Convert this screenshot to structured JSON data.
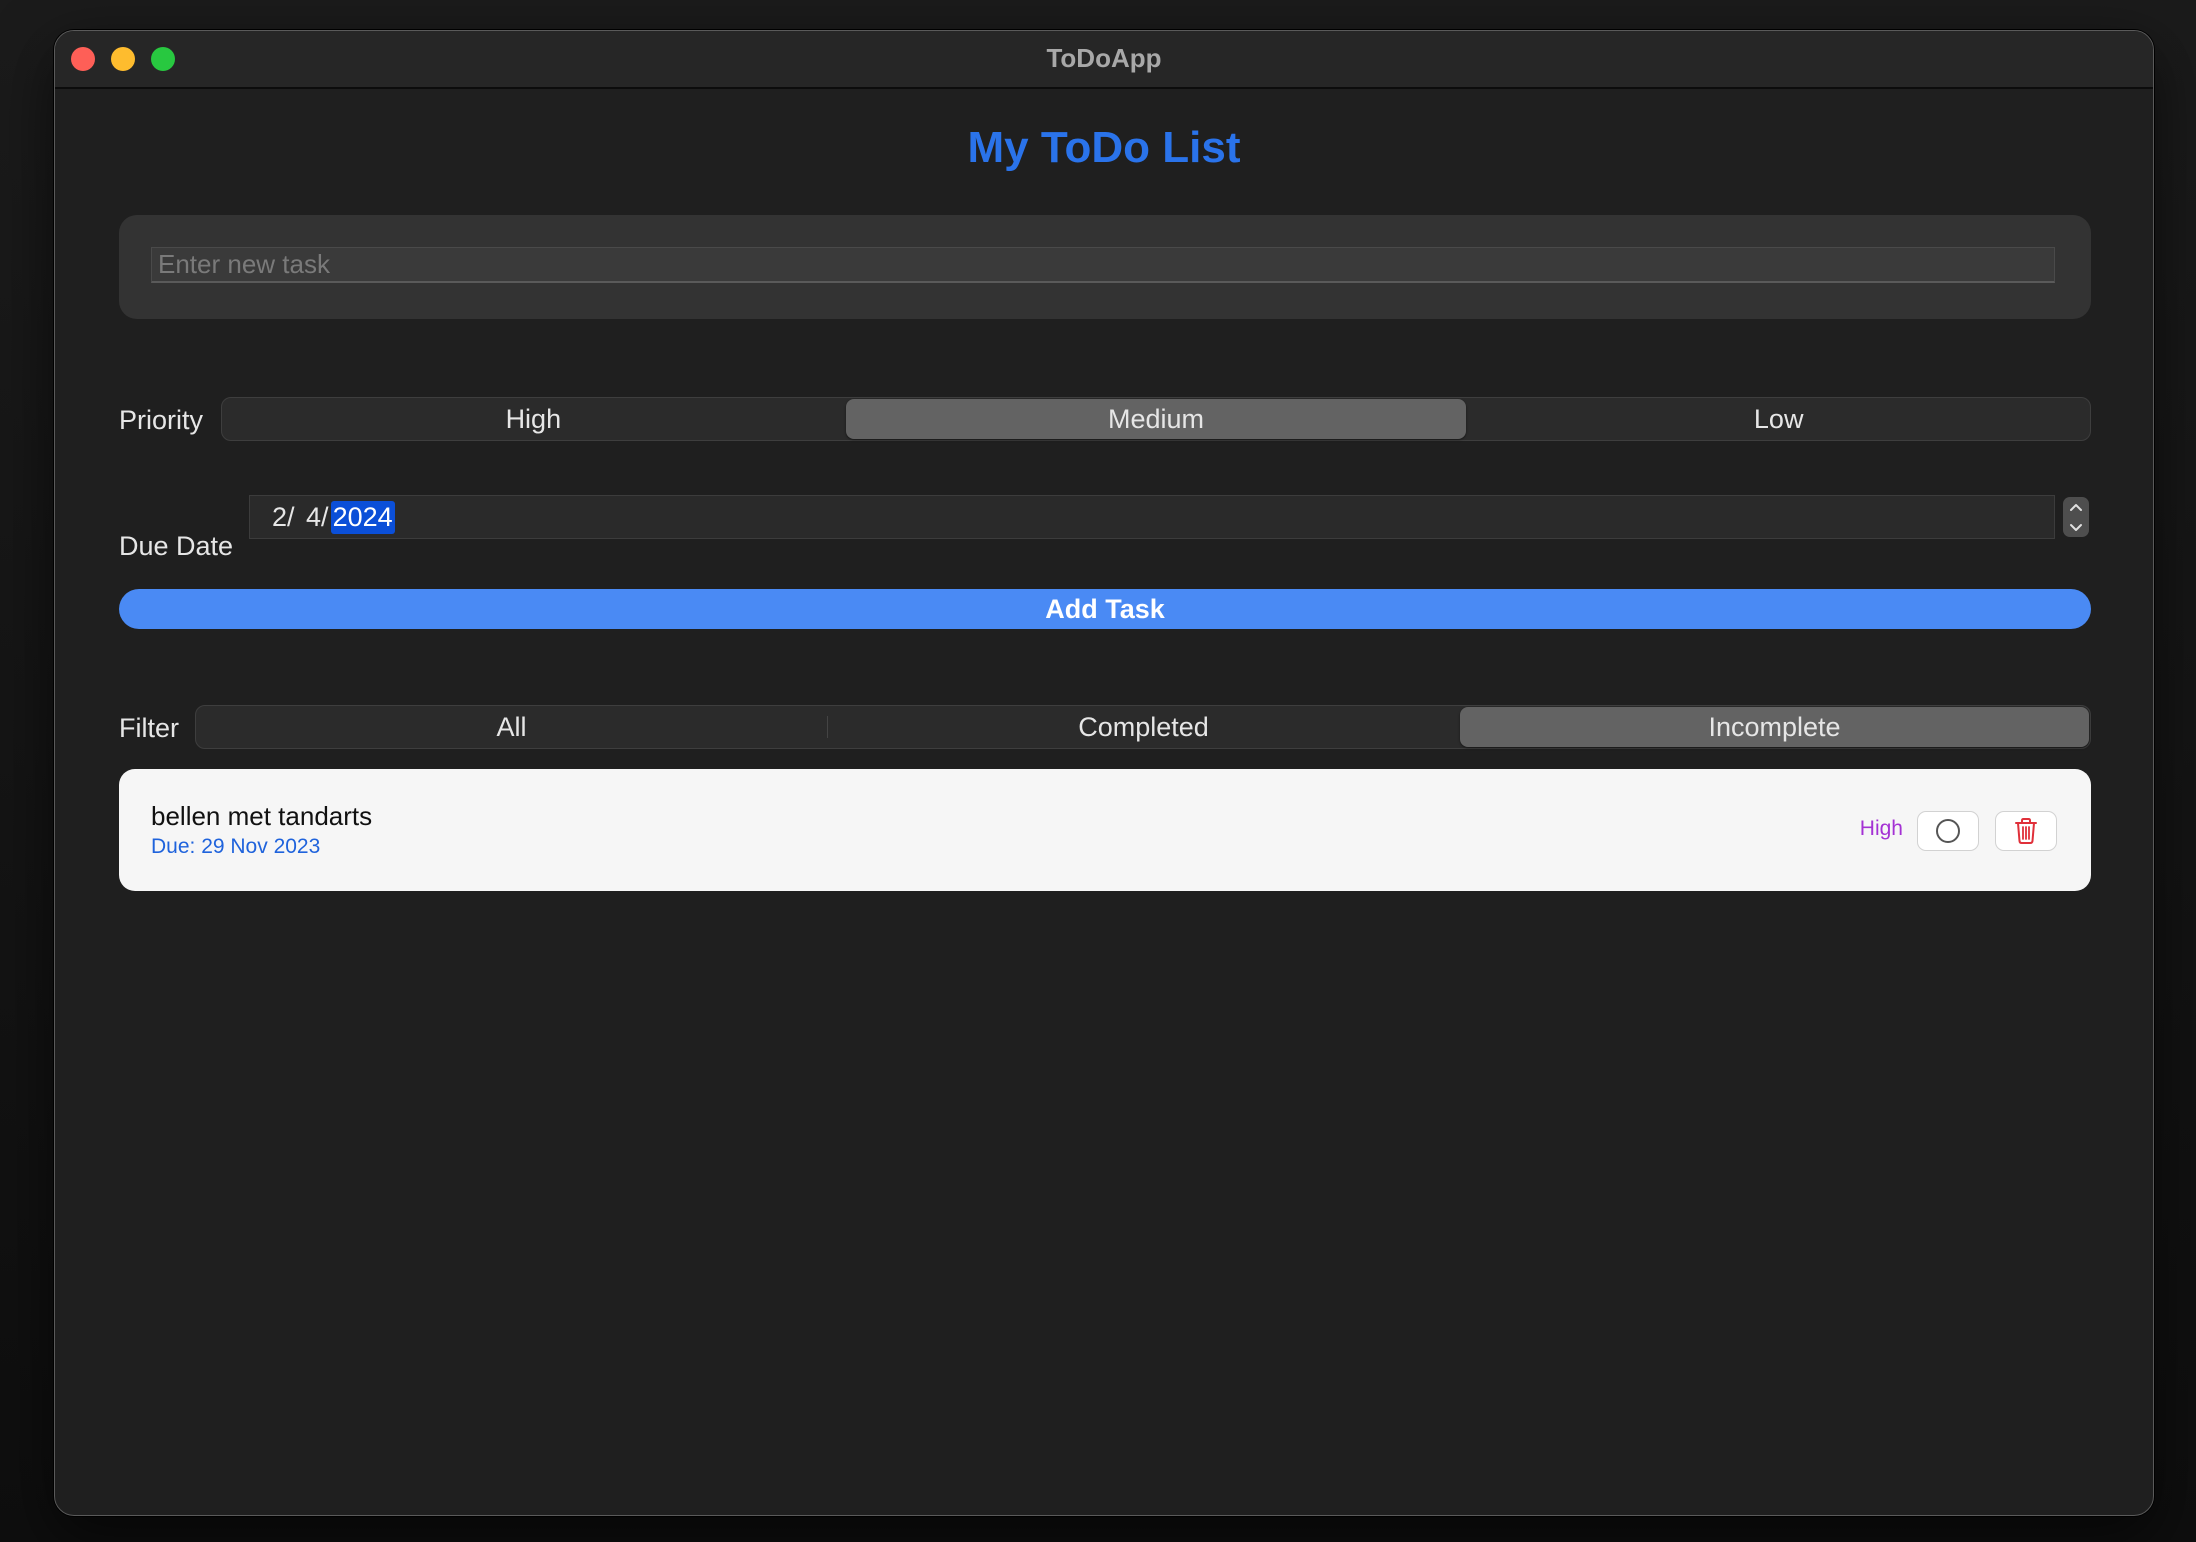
{
  "window": {
    "title": "ToDoApp"
  },
  "app": {
    "title": "My ToDo List"
  },
  "new_task": {
    "value": "",
    "placeholder": "Enter new task"
  },
  "priority": {
    "label": "Priority",
    "options": [
      "High",
      "Medium",
      "Low"
    ],
    "selected": "Medium"
  },
  "due_date": {
    "label": "Due Date",
    "month": "2/",
    "day": " 4/",
    "year": "2024",
    "selected_part": "year"
  },
  "add_button": {
    "label": "Add Task"
  },
  "filter": {
    "label": "Filter",
    "options": [
      "All",
      "Completed",
      "Incomplete"
    ],
    "selected": "Incomplete"
  },
  "tasks": [
    {
      "title": "bellen met tandarts",
      "due": "Due: 29 Nov 2023",
      "priority": "High",
      "completed": false,
      "toggle_icon": "circle-icon",
      "delete_icon": "trash-icon"
    }
  ],
  "colors": {
    "accent": "#2a73ea",
    "button": "#4a8af4",
    "priority_high": "#a431d4",
    "delete": "#e0303a"
  }
}
